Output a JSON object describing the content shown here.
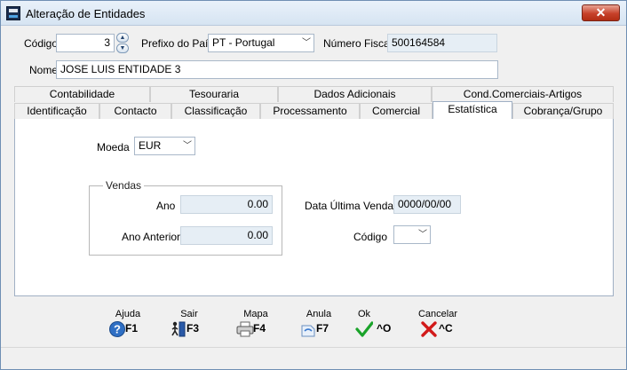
{
  "window": {
    "title": "Alteração de Entidades",
    "close_label": "✕"
  },
  "header": {
    "codigo_label": "Código",
    "codigo_value": "3",
    "prefixo_label": "Prefixo do País",
    "prefixo_value": "PT - Portugal",
    "nif_label": "Número Fiscal",
    "nif_value": "500164584",
    "nome_label": "Nome",
    "nome_value": "JOSE LUIS ENTIDADE 3"
  },
  "tabs_top": [
    "Contabilidade",
    "Tesouraria",
    "Dados Adicionais",
    "Cond.Comerciais-Artigos"
  ],
  "tabs_bottom": [
    "Identificação",
    "Contacto",
    "Classificação",
    "Processamento",
    "Comercial",
    "Estatística",
    "Cobrança/Grupo"
  ],
  "active_tab": "Estatística",
  "estatistica": {
    "moeda_label": "Moeda",
    "moeda_value": "EUR",
    "vendas_title": "Vendas",
    "ano_label": "Ano",
    "ano_value": "0.00",
    "ano_anterior_label": "Ano Anterior",
    "ano_anterior_value": "0.00",
    "data_ultima_venda_label": "Data Última Venda",
    "data_ultima_venda_value": "0000/00/00",
    "codigo_label": "Código",
    "codigo_value": ""
  },
  "footer": {
    "buttons": [
      {
        "caption": "Ajuda",
        "key": "F1",
        "icon": "help-icon"
      },
      {
        "caption": "Sair",
        "key": "F3",
        "icon": "exit-icon"
      },
      {
        "caption": "Mapa",
        "key": "F4",
        "icon": "printer-icon"
      },
      {
        "caption": "Anula",
        "key": "F7",
        "icon": "undo-icon"
      },
      {
        "caption": "Ok",
        "key": "^O",
        "icon": "checkmark-icon"
      },
      {
        "caption": "Cancelar",
        "key": "^C",
        "icon": "cancel-icon"
      }
    ]
  }
}
